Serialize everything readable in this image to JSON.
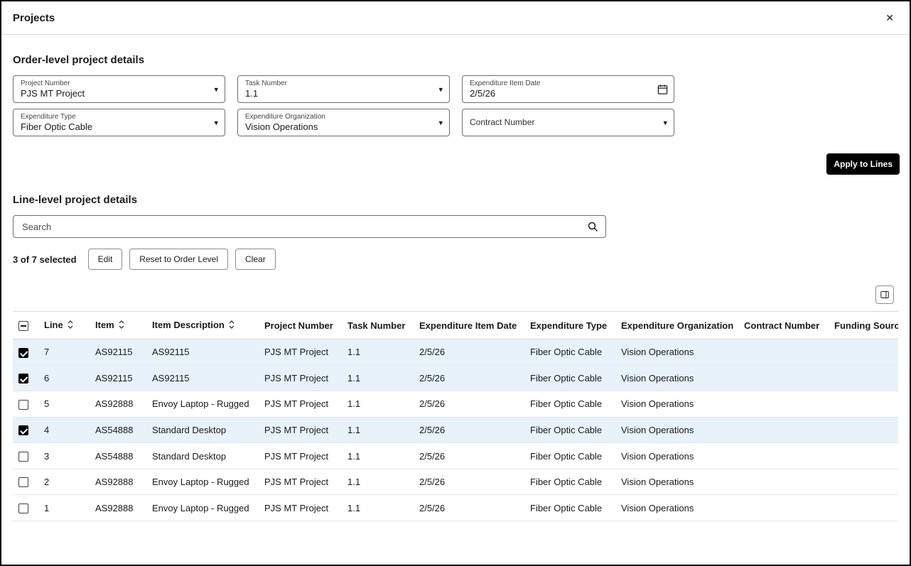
{
  "icons": {
    "close": "✕",
    "chevron_down": "▾"
  },
  "colors": {
    "selected_row": "#e7f2fa",
    "primary_button": "#000000"
  },
  "panel": {
    "title": "Projects"
  },
  "order_section": {
    "title": "Order-level project details",
    "fields": [
      {
        "label": "Project Number",
        "value": "PJS MT Project"
      },
      {
        "label": "Task Number",
        "value": "1.1"
      },
      {
        "label": "Expenditure Item Date",
        "value": "2/5/26"
      },
      {
        "label": "Expenditure Type",
        "value": "Fiber Optic Cable"
      },
      {
        "label": "Expenditure Organization",
        "value": "Vision Operations"
      },
      {
        "label": "Contract Number",
        "value": ""
      }
    ],
    "apply_button_label": "Apply to Lines"
  },
  "line_section": {
    "title": "Line-level project details",
    "search_placeholder": "Search",
    "selection_summary": "3 of 7 selected",
    "edit_button": "Edit",
    "reset_button": "Reset to Order Level",
    "clear_button": "Clear"
  },
  "table": {
    "columns": [
      "Line",
      "Item",
      "Item Description",
      "Project Number",
      "Task Number",
      "Expenditure Item Date",
      "Expenditure Type",
      "Expenditure Organization",
      "Contract Number",
      "Funding Source"
    ],
    "sortable_columns": [
      "Line",
      "Item",
      "Item Description"
    ],
    "rows": [
      {
        "selected": true,
        "line": "7",
        "item": "AS92115",
        "item_description": "AS92115",
        "project_number": "PJS MT Project",
        "task_number": "1.1",
        "expenditure_item_date": "2/5/26",
        "expenditure_type": "Fiber Optic Cable",
        "expenditure_organization": "Vision Operations",
        "contract_number": "",
        "funding_source": ""
      },
      {
        "selected": true,
        "line": "6",
        "item": "AS92115",
        "item_description": "AS92115",
        "project_number": "PJS MT Project",
        "task_number": "1.1",
        "expenditure_item_date": "2/5/26",
        "expenditure_type": "Fiber Optic Cable",
        "expenditure_organization": "Vision Operations",
        "contract_number": "",
        "funding_source": ""
      },
      {
        "selected": false,
        "line": "5",
        "item": "AS92888",
        "item_description": "Envoy Laptop - Rugged",
        "project_number": "PJS MT Project",
        "task_number": "1.1",
        "expenditure_item_date": "2/5/26",
        "expenditure_type": "Fiber Optic Cable",
        "expenditure_organization": "Vision Operations",
        "contract_number": "",
        "funding_source": ""
      },
      {
        "selected": true,
        "line": "4",
        "item": "AS54888",
        "item_description": "Standard Desktop",
        "project_number": "PJS MT Project",
        "task_number": "1.1",
        "expenditure_item_date": "2/5/26",
        "expenditure_type": "Fiber Optic Cable",
        "expenditure_organization": "Vision Operations",
        "contract_number": "",
        "funding_source": ""
      },
      {
        "selected": false,
        "line": "3",
        "item": "AS54888",
        "item_description": "Standard Desktop",
        "project_number": "PJS MT Project",
        "task_number": "1.1",
        "expenditure_item_date": "2/5/26",
        "expenditure_type": "Fiber Optic Cable",
        "expenditure_organization": "Vision Operations",
        "contract_number": "",
        "funding_source": ""
      },
      {
        "selected": false,
        "line": "2",
        "item": "AS92888",
        "item_description": "Envoy Laptop - Rugged",
        "project_number": "PJS MT Project",
        "task_number": "1.1",
        "expenditure_item_date": "2/5/26",
        "expenditure_type": "Fiber Optic Cable",
        "expenditure_organization": "Vision Operations",
        "contract_number": "",
        "funding_source": ""
      },
      {
        "selected": false,
        "line": "1",
        "item": "AS92888",
        "item_description": "Envoy Laptop - Rugged",
        "project_number": "PJS MT Project",
        "task_number": "1.1",
        "expenditure_item_date": "2/5/26",
        "expenditure_type": "Fiber Optic Cable",
        "expenditure_organization": "Vision Operations",
        "contract_number": "",
        "funding_source": ""
      }
    ]
  }
}
